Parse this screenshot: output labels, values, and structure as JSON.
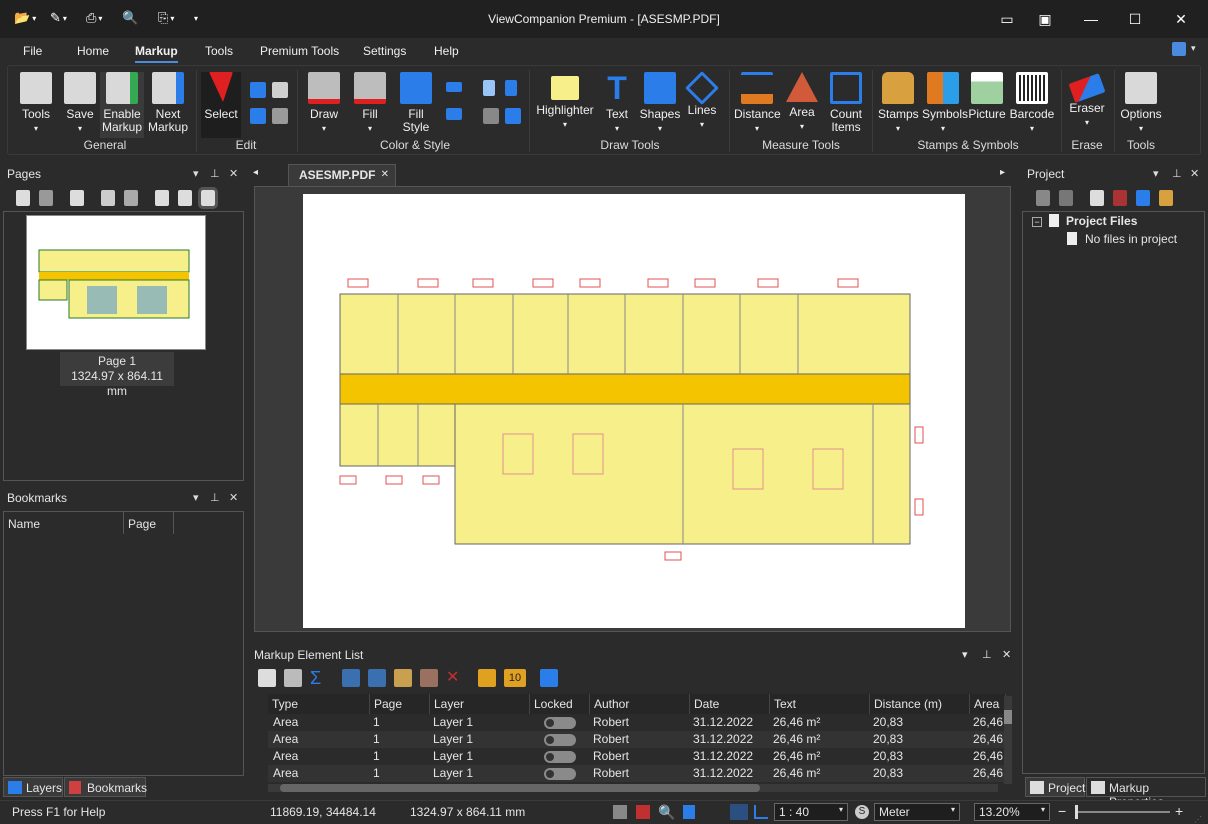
{
  "window": {
    "title": "ViewCompanion Premium - [ASESMP.PDF]"
  },
  "menu": {
    "items": [
      "File",
      "Home",
      "Markup",
      "Tools",
      "Premium Tools",
      "Settings",
      "Help"
    ],
    "active": "Markup"
  },
  "ribbon": {
    "buttons": {
      "tools": "Tools",
      "save": "Save",
      "enable_markup": "Enable\nMarkup",
      "next_markup": "Next\nMarkup",
      "select": "Select",
      "draw": "Draw",
      "fill": "Fill",
      "fill_style": "Fill\nStyle",
      "highlighter": "Highlighter",
      "text": "Text",
      "shapes": "Shapes",
      "lines": "Lines",
      "distance": "Distance",
      "area": "Area",
      "count_items": "Count\nItems",
      "stamps": "Stamps",
      "symbols": "Symbols",
      "picture": "Picture",
      "barcode": "Barcode",
      "eraser": "Eraser",
      "options": "Options"
    },
    "groups": {
      "general": "General",
      "edit": "Edit",
      "color_style": "Color & Style",
      "draw_tools": "Draw Tools",
      "measure_tools": "Measure Tools",
      "stamps_symbols": "Stamps & Symbols",
      "erase": "Erase",
      "tools": "Tools"
    },
    "colors": {
      "accent": "#2b7de9",
      "red": "#e02020",
      "highlighter": "#f7ef8a"
    }
  },
  "pages_panel": {
    "title": "Pages",
    "page_label": "Page 1",
    "page_size": "1324.97 x 864.11 mm"
  },
  "bookmarks_panel": {
    "title": "Bookmarks",
    "col_name": "Name",
    "col_page": "Page"
  },
  "document": {
    "tab": "ASESMP.PDF"
  },
  "project_panel": {
    "title": "Project",
    "root": "Project Files",
    "empty": "No files in project"
  },
  "markup_list": {
    "title": "Markup Element List",
    "count_badge": "10",
    "columns": [
      "Type",
      "Page",
      "Layer",
      "Locked",
      "Author",
      "Date",
      "Text",
      "Distance (m)",
      "Area"
    ],
    "rows": [
      {
        "type": "Area",
        "page": "1",
        "layer": "Layer 1",
        "author": "Robert",
        "date": "31.12.2022",
        "text": "26,46 m²",
        "distance": "20,83",
        "area": "26,46"
      },
      {
        "type": "Area",
        "page": "1",
        "layer": "Layer 1",
        "author": "Robert",
        "date": "31.12.2022",
        "text": "26,46 m²",
        "distance": "20,83",
        "area": "26,46"
      },
      {
        "type": "Area",
        "page": "1",
        "layer": "Layer 1",
        "author": "Robert",
        "date": "31.12.2022",
        "text": "26,46 m²",
        "distance": "20,83",
        "area": "26,46"
      },
      {
        "type": "Area",
        "page": "1",
        "layer": "Layer 1",
        "author": "Robert",
        "date": "31.12.2022",
        "text": "26,46 m²",
        "distance": "20,83",
        "area": "26,46"
      }
    ]
  },
  "bottom_tabs": {
    "layers": "Layers",
    "bookmarks": "Bookmarks",
    "project": "Project",
    "markup_props": "Markup Properties"
  },
  "status": {
    "help": "Press F1 for Help",
    "coords": "11869.19, 34484.14",
    "size": "1324.97 x 864.11 mm",
    "scale": "1 : 40",
    "unit": "Meter",
    "zoom": "13.20%"
  }
}
